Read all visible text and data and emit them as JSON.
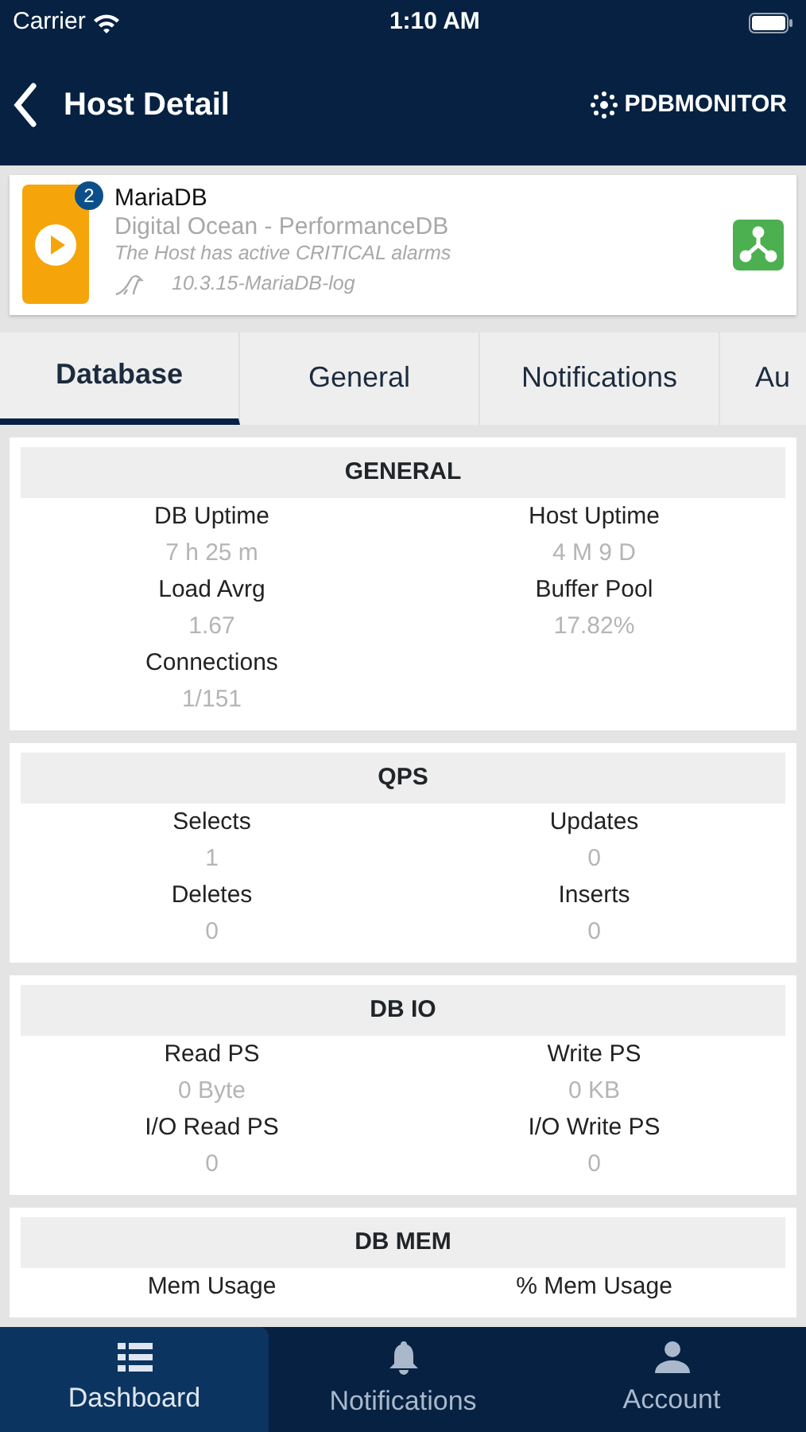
{
  "status_bar": {
    "carrier": "Carrier",
    "time": "1:10 AM"
  },
  "nav": {
    "title": "Host Detail",
    "brand": "PDBMONITOR"
  },
  "host": {
    "badge": "2",
    "name": "MariaDB",
    "provider": "Digital Ocean - PerformanceDB",
    "alert": "The Host has active CRITICAL alarms",
    "version": "10.3.15-MariaDB-log"
  },
  "tabs": [
    {
      "label": "Database",
      "selected": true
    },
    {
      "label": "General",
      "selected": false
    },
    {
      "label": "Notifications",
      "selected": false
    },
    {
      "label": "Au",
      "selected": false
    }
  ],
  "sections": [
    {
      "title": "GENERAL",
      "metrics": [
        {
          "label": "DB Uptime",
          "value": "7 h 25 m"
        },
        {
          "label": "Host Uptime",
          "value": "4 M 9 D"
        },
        {
          "label": "Load Avrg",
          "value": "1.67"
        },
        {
          "label": "Buffer Pool",
          "value": "17.82%"
        },
        {
          "label": "Connections",
          "value": "1/151"
        }
      ]
    },
    {
      "title": "QPS",
      "metrics": [
        {
          "label": "Selects",
          "value": "1"
        },
        {
          "label": "Updates",
          "value": "0"
        },
        {
          "label": "Deletes",
          "value": "0"
        },
        {
          "label": "Inserts",
          "value": "0"
        }
      ]
    },
    {
      "title": "DB IO",
      "metrics": [
        {
          "label": "Read PS",
          "value": "0 Byte"
        },
        {
          "label": "Write PS",
          "value": "0 KB"
        },
        {
          "label": "I/O Read PS",
          "value": "0"
        },
        {
          "label": "I/O Write PS",
          "value": "0"
        }
      ]
    },
    {
      "title": "DB MEM",
      "metrics": [
        {
          "label": "Mem Usage"
        },
        {
          "label": "% Mem Usage"
        }
      ]
    }
  ],
  "bottom_tabs": [
    {
      "label": "Dashboard",
      "kind": "list",
      "selected": true
    },
    {
      "label": "Notifications",
      "kind": "bell",
      "selected": false
    },
    {
      "label": "Account",
      "kind": "person",
      "selected": false
    }
  ]
}
